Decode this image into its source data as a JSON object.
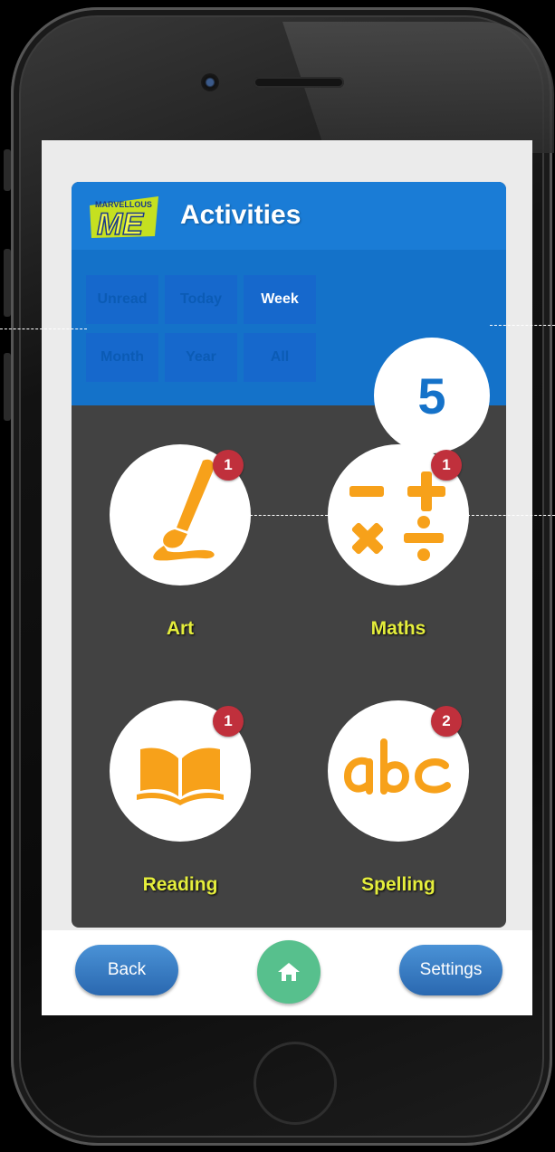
{
  "app": {
    "title": "Activities",
    "logo_text_top": "MARVELLOUS",
    "logo_text_main": "ME"
  },
  "filters": [
    "Unread",
    "Today",
    "Week",
    "Month",
    "Year",
    "All"
  ],
  "active_filter": "Week",
  "count": "5",
  "activities": [
    {
      "label": "Art",
      "badge": "1",
      "icon": "paintbrush-icon"
    },
    {
      "label": "Maths",
      "badge": "1",
      "icon": "math-operators-icon"
    },
    {
      "label": "Reading",
      "badge": "1",
      "icon": "open-book-icon"
    },
    {
      "label": "Spelling",
      "badge": "2",
      "icon": "abc-icon"
    }
  ],
  "footer": {
    "back_label": "Back",
    "settings_label": "Settings",
    "home_icon": "home-icon"
  },
  "colors": {
    "header_blue": "#1a7cd6",
    "panel_gray": "#424242",
    "icon_orange": "#f7a11a",
    "label_yellow": "#e5ee3c",
    "badge_red": "#c0303c",
    "home_green": "#57c08d"
  }
}
